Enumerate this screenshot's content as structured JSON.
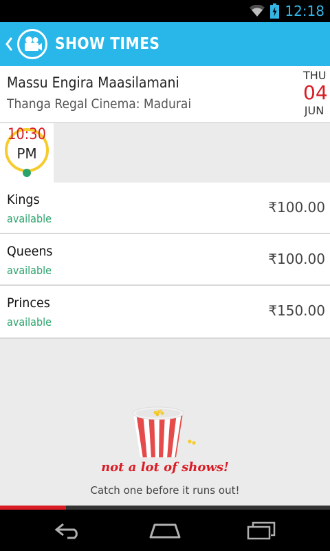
{
  "status_bar": {
    "time": "12:18"
  },
  "action_bar": {
    "title": "SHOW TIMES"
  },
  "movie": {
    "title": "Massu Engira Maasilamani",
    "cinema": "Thanga Regal Cinema: Madurai",
    "date": {
      "day": "THU",
      "number": "04",
      "month": "JUN"
    }
  },
  "showtime": {
    "hour": "10:30",
    "ampm": "PM"
  },
  "seats": [
    {
      "name": "Kings",
      "status": "available",
      "price": "₹100.00"
    },
    {
      "name": "Queens",
      "status": "available",
      "price": "₹100.00"
    },
    {
      "name": "Princes",
      "status": "available",
      "price": "₹150.00"
    }
  ],
  "empty_state": {
    "tagline": "not a lot of shows!",
    "subtitle": "Catch one before it runs out!"
  },
  "progress": {
    "fraction": 0.2
  },
  "colors": {
    "accent": "#29b6e9",
    "brand_red": "#d81b24",
    "available_green": "#2aa36b",
    "time_ring": "#f6cb2e"
  }
}
